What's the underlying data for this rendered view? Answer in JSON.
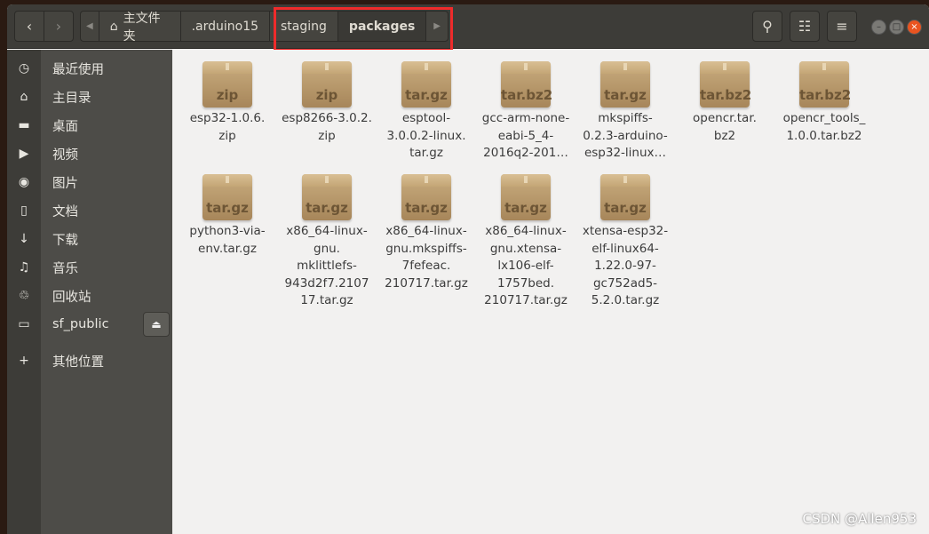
{
  "breadcrumb": {
    "home": "主文件夹",
    "items": [
      ".arduino15",
      "staging",
      "packages"
    ]
  },
  "sidebar": [
    {
      "icon": "◷",
      "label": "最近使用",
      "name": "recent"
    },
    {
      "icon": "⌂",
      "label": "主目录",
      "name": "home"
    },
    {
      "icon": "▬",
      "label": "桌面",
      "name": "desktop"
    },
    {
      "icon": "▶",
      "label": "视频",
      "name": "videos"
    },
    {
      "icon": "◉",
      "label": "图片",
      "name": "pictures"
    },
    {
      "icon": "▯",
      "label": "文档",
      "name": "documents"
    },
    {
      "icon": "↓",
      "label": "下载",
      "name": "downloads"
    },
    {
      "icon": "♫",
      "label": "音乐",
      "name": "music"
    },
    {
      "icon": "♲",
      "label": "回收站",
      "name": "trash"
    },
    {
      "icon": "▭",
      "label": "sf_public",
      "name": "sf-public"
    },
    {
      "icon": "+",
      "label": "其他位置",
      "name": "other-locations"
    }
  ],
  "files": [
    {
      "type": "zip",
      "lines": [
        "esp32-1.0.6.",
        "zip"
      ]
    },
    {
      "type": "zip",
      "lines": [
        "esp8266-3.0.2.",
        "zip"
      ]
    },
    {
      "type": "tar.gz",
      "lines": [
        "esptool-",
        "3.0.0.2-linux.",
        "tar.gz"
      ]
    },
    {
      "type": "tar.bz2",
      "lines": [
        "gcc-arm-none-",
        "eabi-5_4-",
        "2016q2-201…"
      ]
    },
    {
      "type": "tar.gz",
      "lines": [
        "mkspiffs-",
        "0.2.3-arduino-",
        "esp32-linux…"
      ]
    },
    {
      "type": "tar.bz2",
      "lines": [
        "opencr.tar.",
        "bz2"
      ]
    },
    {
      "type": "tar.bz2",
      "lines": [
        "opencr_tools_",
        "1.0.0.tar.bz2"
      ]
    },
    {
      "type": "tar.gz",
      "lines": [
        "python3-via-",
        "env.tar.gz"
      ]
    },
    {
      "type": "tar.gz",
      "lines": [
        "x86_64-linux-",
        "gnu.",
        "mklittlefs-",
        "943d2f7.2107",
        "17.tar.gz"
      ]
    },
    {
      "type": "tar.gz",
      "lines": [
        "x86_64-linux-",
        "gnu.mkspiffs-",
        "7fefeac.",
        "210717.tar.gz"
      ]
    },
    {
      "type": "tar.gz",
      "lines": [
        "x86_64-linux-",
        "gnu.xtensa-",
        "lx106-elf-",
        "1757bed.",
        "210717.tar.gz"
      ]
    },
    {
      "type": "tar.gz",
      "lines": [
        "xtensa-esp32-",
        "elf-linux64-",
        "1.22.0-97-",
        "gc752ad5-",
        "5.2.0.tar.gz"
      ]
    }
  ],
  "watermark": "CSDN @Allen953"
}
